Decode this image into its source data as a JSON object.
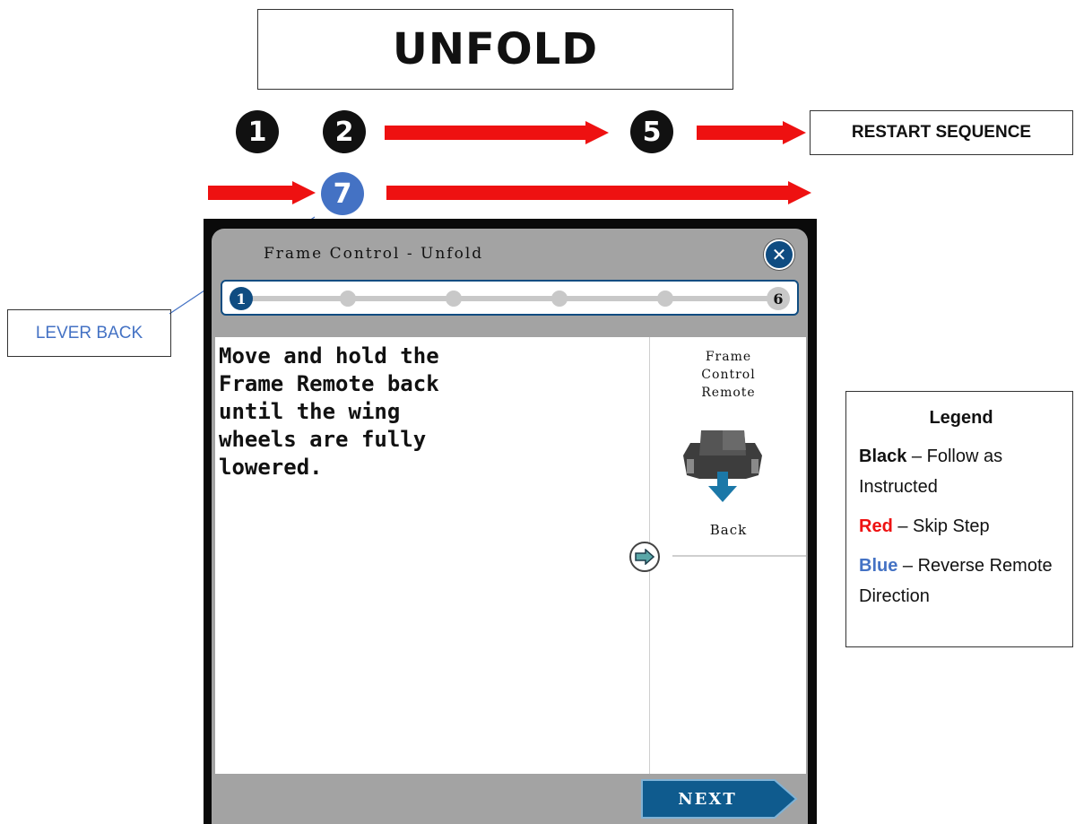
{
  "header": {
    "title": "UNFOLD"
  },
  "sequence": {
    "top_row": [
      "1",
      "2",
      "5"
    ],
    "bottom_row": [
      "7"
    ],
    "restart_label": "RESTART SEQUENCE",
    "lever_label": "LEVER BACK"
  },
  "legend": {
    "title": "Legend",
    "items": [
      {
        "key": "Black",
        "text": " – Follow as Instructed",
        "color": "#111111"
      },
      {
        "key": "Red",
        "text": " – Skip Step",
        "color": "#ee1111"
      },
      {
        "key": "Blue",
        "text": " – Reverse Remote Direction",
        "color": "#4472c4"
      }
    ]
  },
  "screen": {
    "title": "Frame Control  -  Unfold",
    "close_icon": "close-icon",
    "progress": {
      "current": "1",
      "last": "6"
    },
    "instruction": "Move and hold the\nFrame Remote back\nuntil the wing\nwheels are fully\nlowered.",
    "panel_label": "Frame\nControl\nRemote",
    "remote_caption": "Back",
    "next_label": "NEXT"
  },
  "colors": {
    "arrow_red": "#ee1111",
    "reverse_blue": "#4472c4",
    "device_blue": "#0f4c81"
  }
}
